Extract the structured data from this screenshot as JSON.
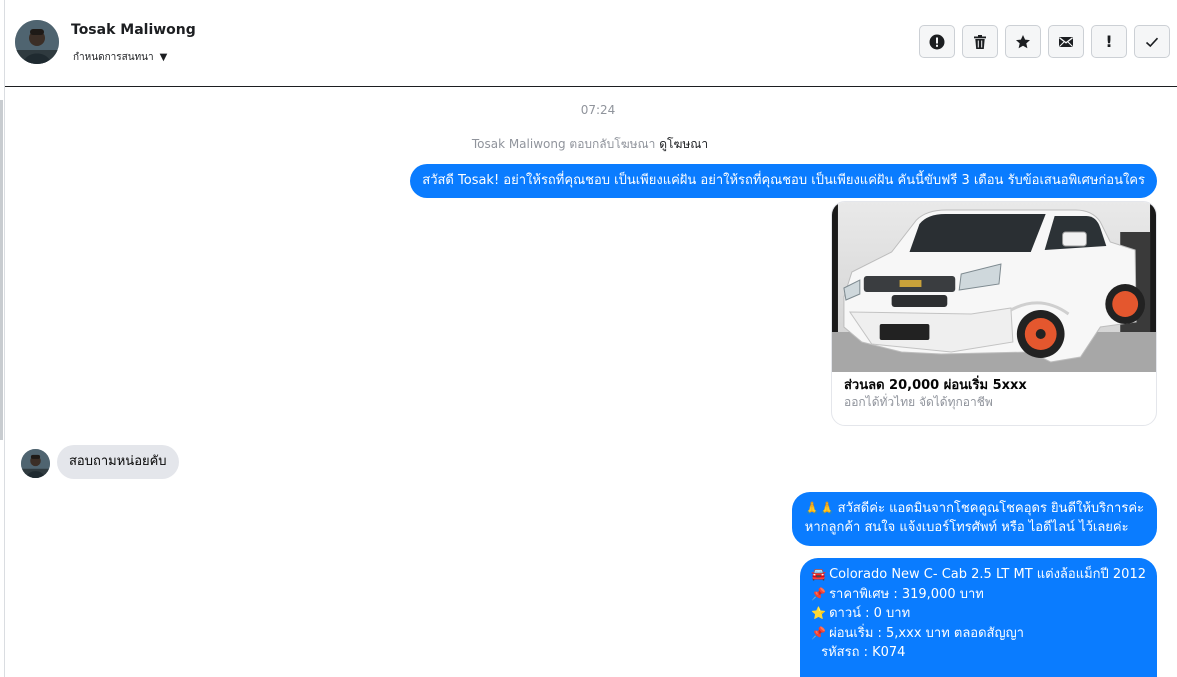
{
  "header": {
    "contact_name": "Tosak Maliwong",
    "assign_label": "กำหนดการสนทนา",
    "toolbar": [
      {
        "name": "spam-button",
        "icon": "alert-circle-icon"
      },
      {
        "name": "delete-button",
        "icon": "trash-icon"
      },
      {
        "name": "star-button",
        "icon": "star-icon"
      },
      {
        "name": "mark-unread-button",
        "icon": "envelope-icon"
      },
      {
        "name": "follow-up-button",
        "icon": "exclamation-icon"
      },
      {
        "name": "mark-done-button",
        "icon": "checkmark-icon"
      }
    ]
  },
  "conversation": {
    "timestamp": "07:24",
    "ad_reply_prefix": "Tosak Maliwong ตอบกลับโฆษณา",
    "ad_reply_link": "ดูโฆษณา",
    "messages": {
      "greeting": "สวัสดี Tosak! อย่าให้รถที่คุณชอบ เป็นเพียงแค่ฝัน อย่าให้รถที่คุณชอบ เป็นเพียงแค่ฝัน คันนี้ขับฟรี 3 เดือน รับข้อเสนอพิเศษก่อนใคร",
      "ad_card": {
        "title": "ส่วนลด 20,000 ผ่อนเริ่ม 5xxx",
        "subtitle": "ออกได้ทั่วไทย จัดได้ทุกอาชีพ"
      },
      "customer_message": "สอบถามหน่อยคับ",
      "admin_reply_line1": "สวัสดีค่ะ แอดมินจากโชคคูณโชคอุดร ยินดีให้บริการค่ะ",
      "admin_reply_line2": "หากลูกค้า สนใจ แจ้งเบอร์โทรศัพท์ หรือ ไอดีไลน์ ไว้เลยค่ะ",
      "car_details": {
        "model": "Colorado New C- Cab 2.5 LT MT แต่งล้อแม็กปี 2012",
        "price": "ราคาพิเศษ : 319,000 บาท",
        "down": "ดาวน์ : 0 บาท",
        "installment": "ผ่อนเริ่ม : 5,xxx บาท ตลอดสัญญา",
        "code": "รหัสรถ : K074"
      }
    }
  },
  "colors": {
    "outgoing_bubble": "#0a7cff",
    "incoming_bubble": "#e4e6eb",
    "meta_text": "#90949c"
  }
}
